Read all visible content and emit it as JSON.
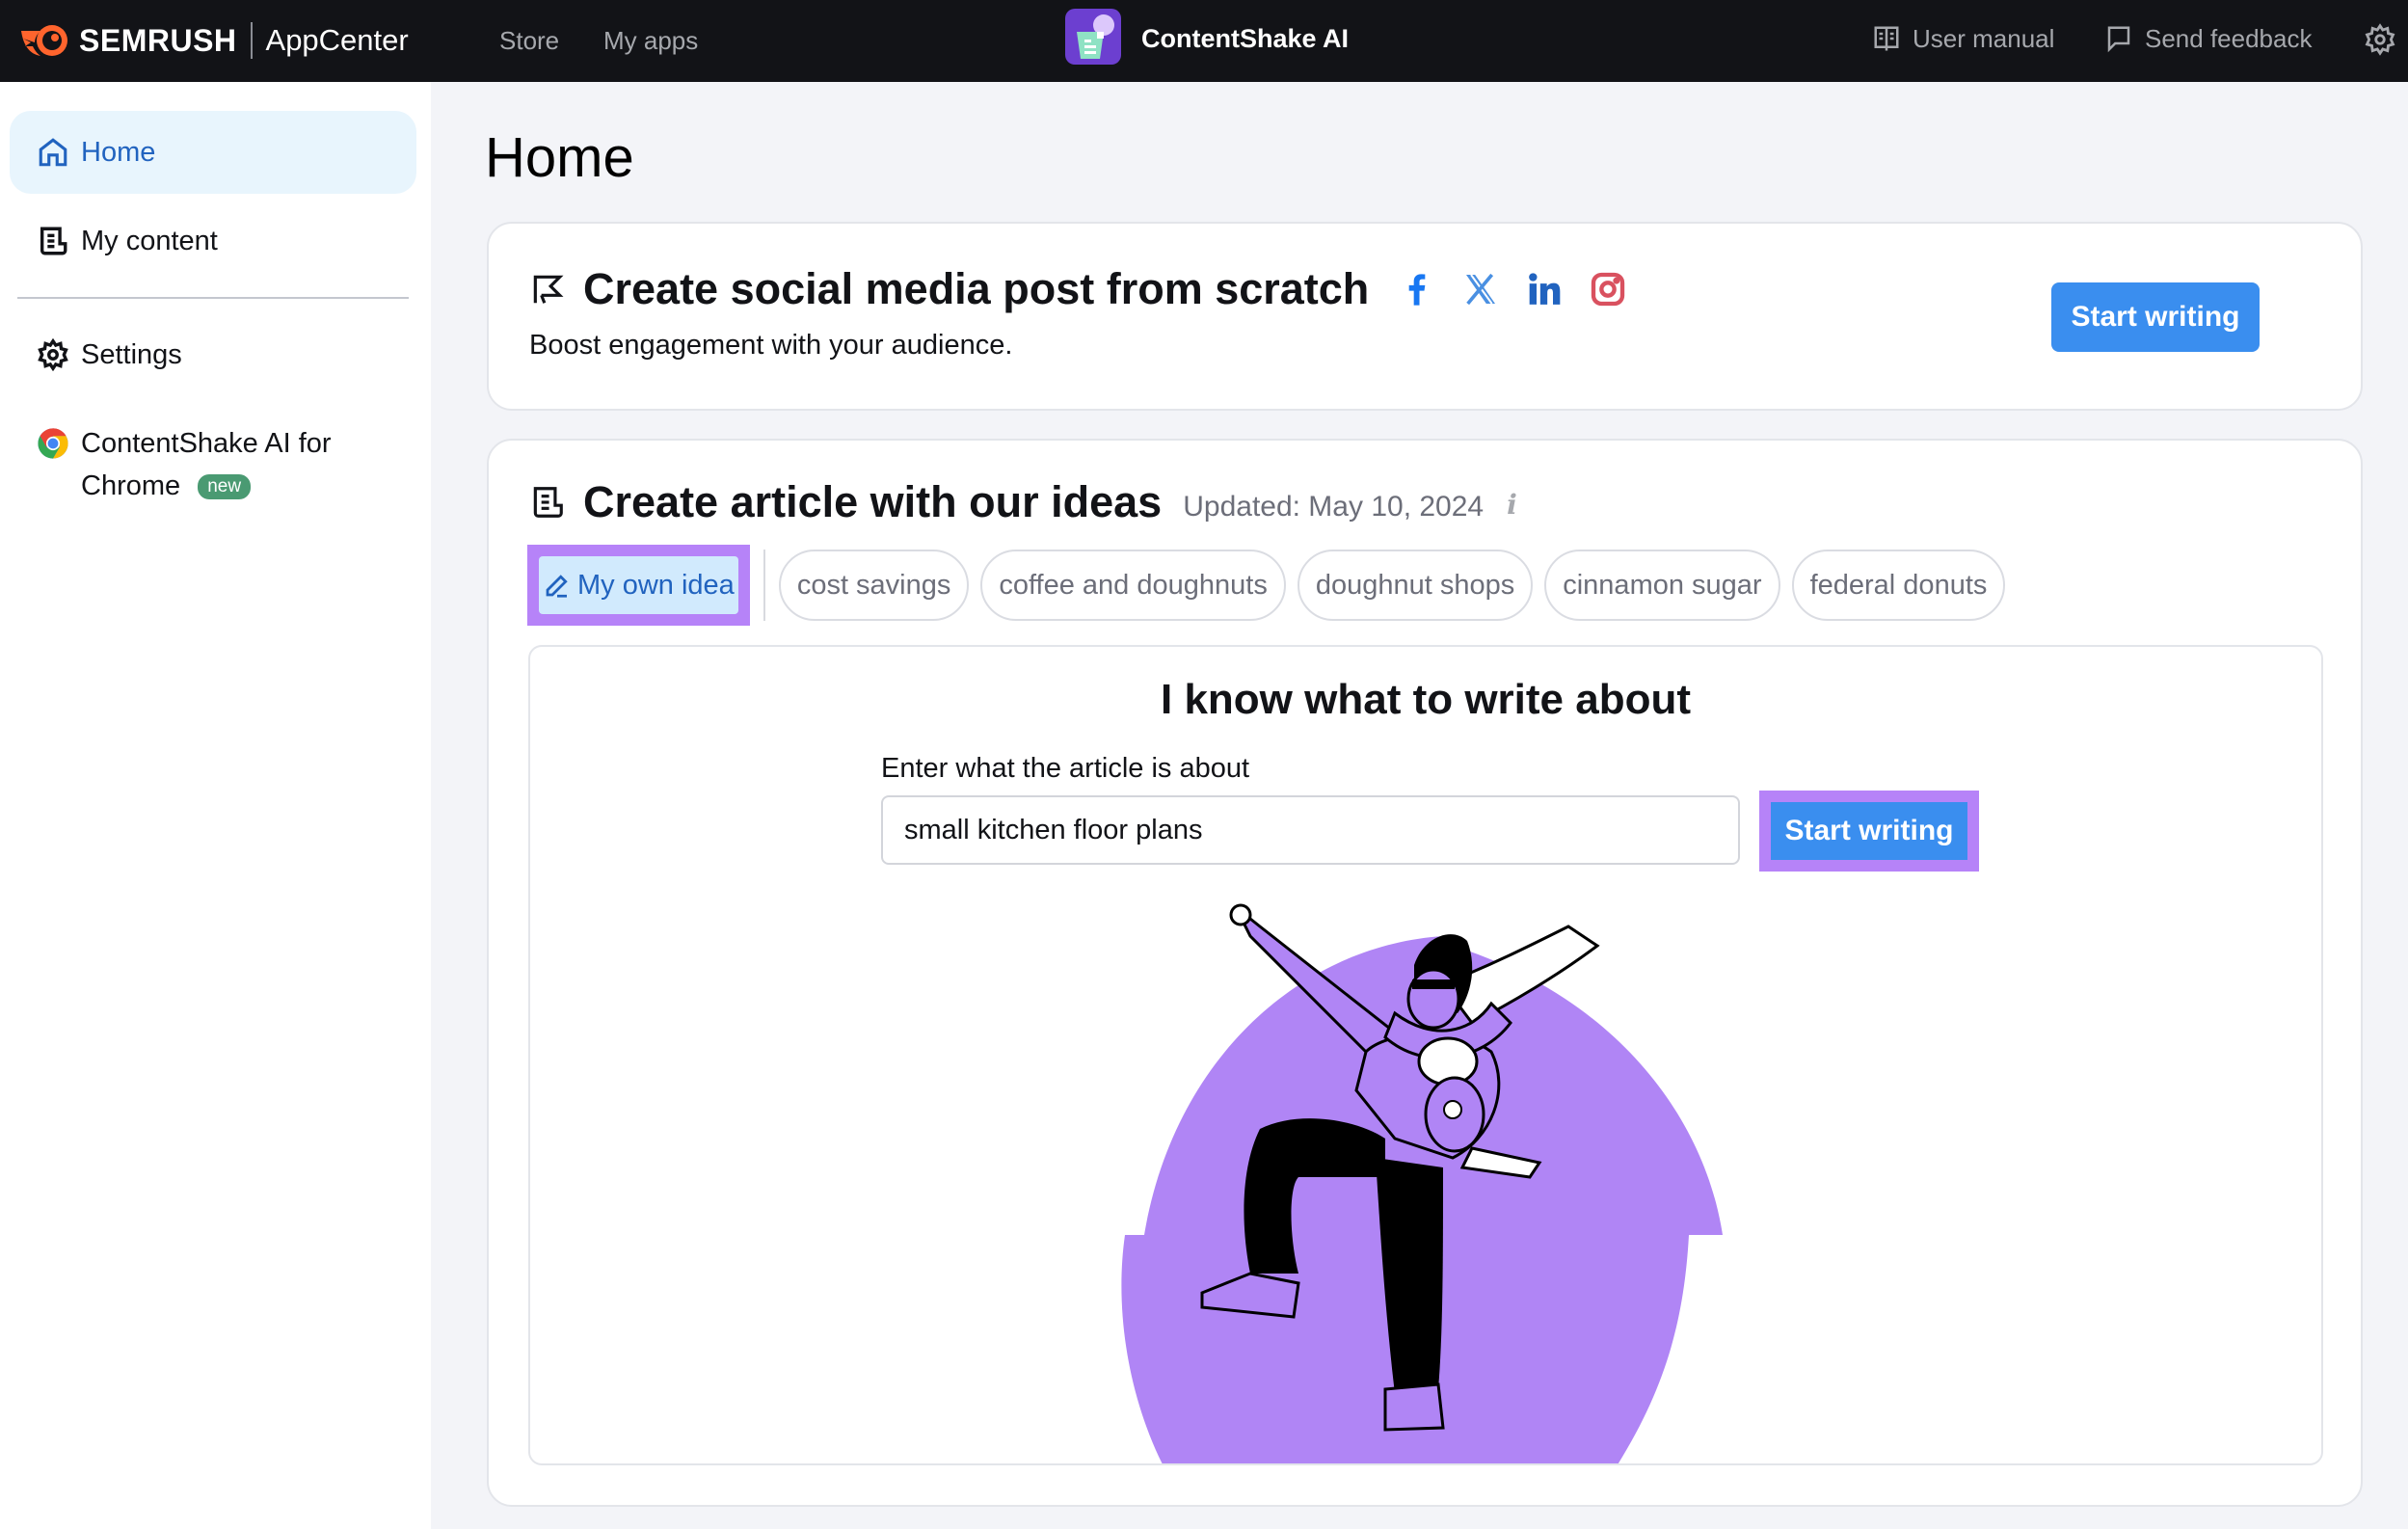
{
  "header": {
    "brand": "SEMRUSH",
    "product": "AppCenter",
    "nav": [
      {
        "label": "Store"
      },
      {
        "label": "My apps"
      }
    ],
    "app_name": "ContentShake AI",
    "user_manual": "User manual",
    "send_feedback": "Send feedback",
    "icons": {
      "manual": "book-icon",
      "feedback": "message-icon",
      "settings": "gear-icon"
    }
  },
  "sidebar": {
    "items": [
      {
        "label": "Home",
        "icon": "home-icon",
        "active": true
      },
      {
        "label": "My content",
        "icon": "document-icon",
        "active": false
      },
      {
        "label": "Settings",
        "icon": "gear-icon",
        "active": false
      },
      {
        "label": "ContentShake AI for Chrome",
        "icon": "chrome-icon",
        "badge": "new",
        "active": false
      }
    ]
  },
  "main": {
    "title": "Home",
    "social_card": {
      "title": "Create social media post from scratch",
      "subtitle": "Boost engagement with your audience.",
      "networks": [
        "facebook",
        "x",
        "linkedin",
        "instagram"
      ],
      "button": "Start writing"
    },
    "article_card": {
      "title": "Create article with our ideas",
      "updated": "Updated: May 10, 2024",
      "info_icon": "i",
      "own_idea_chip": "My own idea",
      "topic_chips": [
        "cost savings",
        "coffee and doughnuts",
        "doughnut shops",
        "cinnamon sugar",
        "federal donuts"
      ],
      "panel": {
        "title": "I know what to write about",
        "field_label": "Enter what the article is about",
        "field_value": "small kitchen floor plans",
        "button": "Start writing"
      }
    }
  },
  "colors": {
    "header_bg": "#121317",
    "accent_blue": "#3a8eef",
    "active_nav_bg": "#e8f5fd",
    "active_nav_text": "#2163bf",
    "highlight_purple": "#b683f8",
    "illustration_purple": "#b085f5",
    "badge_green": "#4a9a72"
  }
}
